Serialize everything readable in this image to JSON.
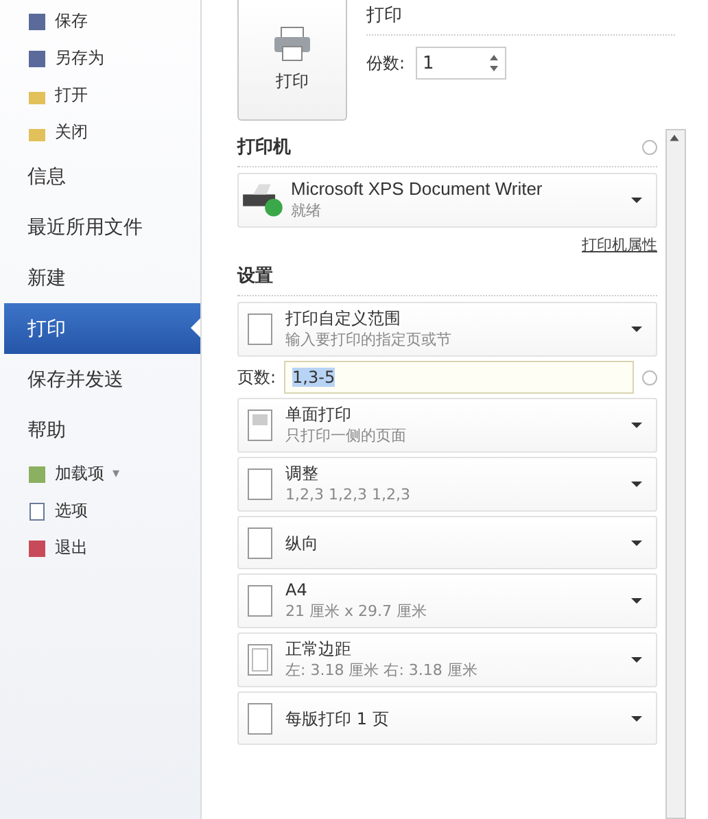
{
  "sidebar": {
    "items": [
      {
        "label": "保存",
        "kind": "small",
        "selected": false
      },
      {
        "label": "另存为",
        "kind": "small",
        "selected": false
      },
      {
        "label": "打开",
        "kind": "small",
        "selected": false
      },
      {
        "label": "关闭",
        "kind": "small",
        "selected": false
      },
      {
        "label": "信息",
        "kind": "big",
        "selected": false
      },
      {
        "label": "最近所用文件",
        "kind": "big",
        "selected": false
      },
      {
        "label": "新建",
        "kind": "big",
        "selected": false
      },
      {
        "label": "打印",
        "kind": "big",
        "selected": true
      },
      {
        "label": "保存并发送",
        "kind": "big",
        "selected": false
      },
      {
        "label": "帮助",
        "kind": "big",
        "selected": false
      },
      {
        "label": "加载项",
        "kind": "small",
        "selected": false,
        "caret": "▾"
      },
      {
        "label": "选项",
        "kind": "small",
        "selected": false
      },
      {
        "label": "退出",
        "kind": "small",
        "selected": false
      }
    ]
  },
  "print": {
    "button": "打印",
    "title": "打印",
    "copies_label": "份数:",
    "copies": "1"
  },
  "printer": {
    "heading": "打印机",
    "name": "Microsoft XPS Document Writer",
    "status": "就绪",
    "properties_link": "打印机属性"
  },
  "settings": {
    "heading": "设置",
    "pages_label": "页数:",
    "pages_value": "1,3-5",
    "options": [
      {
        "title": "打印自定义范围",
        "subtitle": "输入要打印的指定页或节"
      },
      {
        "title": "单面打印",
        "subtitle": "只打印一侧的页面"
      },
      {
        "title": "调整",
        "subtitle": "1,2,3    1,2,3    1,2,3"
      },
      {
        "title": "纵向"
      },
      {
        "title": "A4",
        "subtitle": "21 厘米 x 29.7 厘米"
      },
      {
        "title": "正常边距",
        "subtitle": "左: 3.18 厘米    右: 3.18 厘米"
      },
      {
        "title": "每版打印 1 页"
      }
    ]
  }
}
